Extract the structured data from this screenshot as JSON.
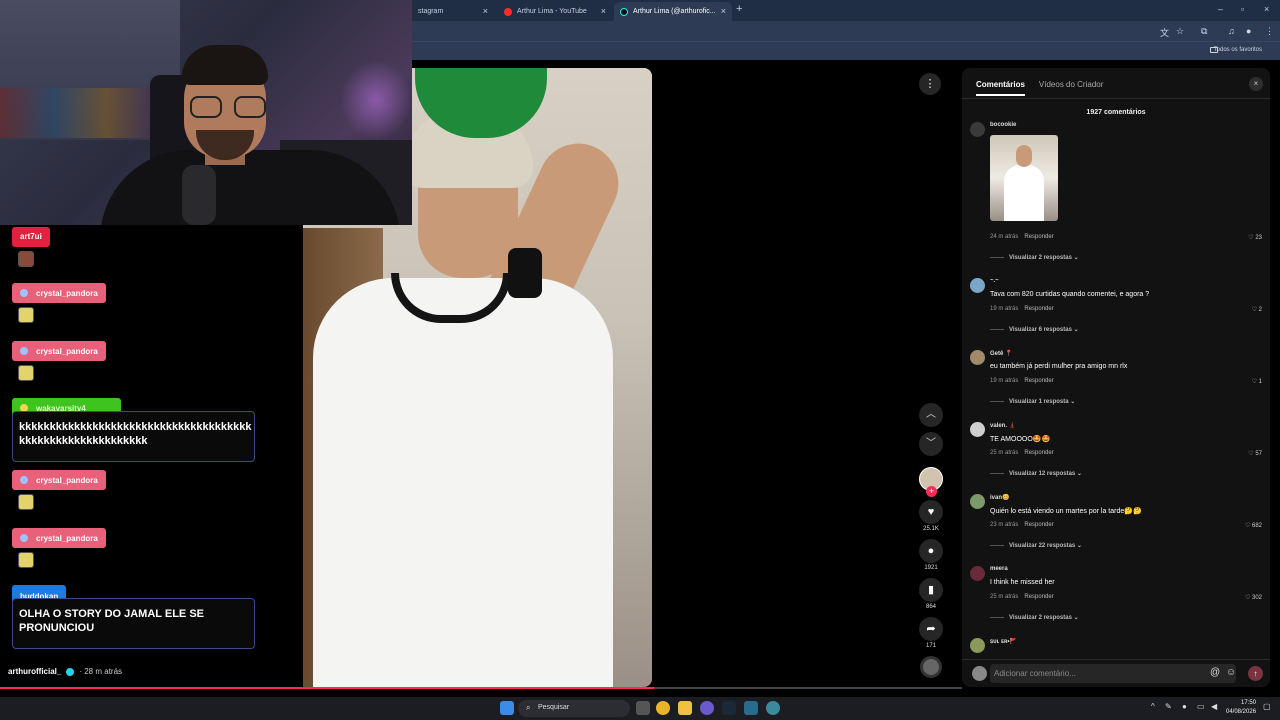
{
  "browser": {
    "tabs": [
      {
        "label": "stagram"
      },
      {
        "label": "Arthur Lima - YouTube"
      },
      {
        "label": "Arthur Lima (@arthurofic..."
      }
    ],
    "bookmarks_label": "Todos os favoritos"
  },
  "chat": {
    "messages": [
      {
        "user": "art7ui",
        "color": "#e0213f"
      },
      {
        "user": "crystal_pandora",
        "color": "#e8607a"
      },
      {
        "user": "crystal_pandora",
        "color": "#e8607a"
      },
      {
        "user": "wakavarsity4",
        "color": "#3ec31f",
        "text": "kkkkkkkkkkkkkkkkkkkkkkkkkkkkkkkkkkkkkk kkkkkkkkkkkkkkkkkkkkk"
      },
      {
        "user": "crystal_pandora",
        "color": "#e8607a"
      },
      {
        "user": "crystal_pandora",
        "color": "#e8607a"
      },
      {
        "user": "buddokan",
        "color": "#1e7ae0",
        "text": "OLHA O STORY DO JAMAL ELE SE PRONUNCIOU"
      }
    ]
  },
  "video": {
    "creator": "arthurofficial_",
    "time_ago": "· 28 m atrás",
    "progress": 0.68,
    "actions": {
      "likes": "25.1K",
      "comments": "1921",
      "saves": "864",
      "shares": "171"
    }
  },
  "comments_panel": {
    "tab_comments": "Comentários",
    "tab_creator_videos": "Vídeos do Criador",
    "count_label": "1927 comentários",
    "reply_label": "Responder",
    "comments": [
      {
        "user": "bocookie",
        "text": "",
        "time": "24 m atrás",
        "likes": "23",
        "view_replies": "Visualizar 2 respostas ⌄"
      },
      {
        "user": "~.~",
        "text": "Tava com 820 curtidas quando comentei, e agora ?",
        "time": "19 m atrás",
        "likes": "2",
        "view_replies": "Visualizar 6 respostas ⌄"
      },
      {
        "user": "Getê 📍",
        "text": "eu também já perdi mulher pra amigo mn rlx",
        "time": "19 m atrás",
        "likes": "1",
        "view_replies": "Visualizar 1 resposta ⌄"
      },
      {
        "user": "valen. 🗼",
        "text": "TE AMOOOO🤩🤩",
        "time": "25 m atrás",
        "likes": "57",
        "view_replies": "Visualizar 12 respostas ⌄"
      },
      {
        "user": "ivan😊",
        "text": "Quién lo está viendo un martes por la tarde🤔🤔",
        "time": "23 m atrás",
        "likes": "682",
        "view_replies": "Visualizar 22 respostas ⌄"
      },
      {
        "user": "meera",
        "text": "I think he missed her",
        "time": "25 m atrás",
        "likes": "302",
        "view_replies": "Visualizar 2 respostas ⌄"
      },
      {
        "user": "ꜱᴜʟ ᴇʀ•🚩",
        "text": "",
        "time": "",
        "likes": "",
        "view_replies": ""
      }
    ],
    "add_placeholder": "Adicionar comentário..."
  },
  "taskbar": {
    "search_label": "Pesquisar",
    "time": "17:50",
    "date": "04/08/2026"
  }
}
